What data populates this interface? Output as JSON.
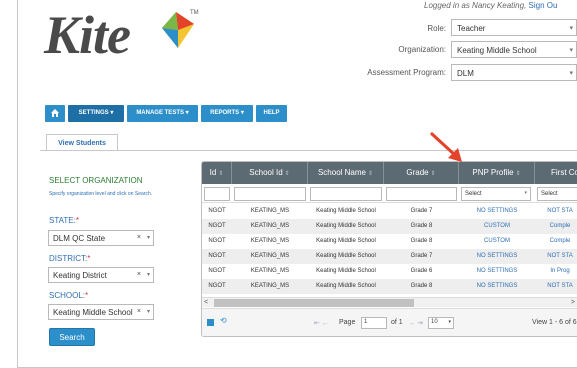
{
  "header": {
    "logo_text": "Kite",
    "logo_tm": "TM",
    "login_text": "Logged in as Nancy Keating,",
    "signout_text": "Sign Ou",
    "role_label": "Role:",
    "role_value": "Teacher",
    "organization_label": "Organization:",
    "organization_value": "Keating Middle School",
    "program_label": "Assessment Program:",
    "program_value": "DLM"
  },
  "nav": {
    "home_icon": "home-icon",
    "items": [
      "SETTINGS ▾",
      "MANAGE TESTS ▾",
      "REPORTS ▾",
      "HELP"
    ]
  },
  "tabs": {
    "view_students": "View Students"
  },
  "left_panel": {
    "title": "SELECT ORGANIZATION",
    "hint": "Specify organization level and click on Search.",
    "state_label": "STATE:",
    "state_value": "DLM QC State",
    "district_label": "DISTRICT:",
    "district_value": "Keating District",
    "school_label": "SCHOOL:",
    "school_value": "Keating Middle School",
    "required_mark": "*",
    "clear_symbol": "×",
    "dropdown_symbol": "▾",
    "search_button": "Search"
  },
  "grid": {
    "columns": [
      "Id",
      "School Id",
      "School Name",
      "Grade",
      "PNP Profile",
      "First Co"
    ],
    "sort_glyph": "⇕",
    "filter_placeholder": "Select",
    "rows": [
      {
        "id": "NGOT",
        "school_id": "KEATING_MS",
        "school_name": "Keating Middle School",
        "grade": "Grade 7",
        "pnp": "NO SETTINGS",
        "first": "NOT STA"
      },
      {
        "id": "NGOT",
        "school_id": "KEATING_MS",
        "school_name": "Keating Middle School",
        "grade": "Grade 8",
        "pnp": "CUSTOM",
        "first": "Comple"
      },
      {
        "id": "NGOT",
        "school_id": "KEATING_MS",
        "school_name": "Keating Middle School",
        "grade": "Grade 8",
        "pnp": "CUSTOM",
        "first": "Comple"
      },
      {
        "id": "NGOT",
        "school_id": "KEATING_MS",
        "school_name": "Keating Middle School",
        "grade": "Grade 7",
        "pnp": "NO SETTINGS",
        "first": "NOT STA"
      },
      {
        "id": "NGOT",
        "school_id": "KEATING_MS",
        "school_name": "Keating Middle School",
        "grade": "Grade 6",
        "pnp": "NO SETTINGS",
        "first": "In Prog"
      },
      {
        "id": "NGOT",
        "school_id": "KEATING_MS",
        "school_name": "Keating Middle School",
        "grade": "Grade 8",
        "pnp": "NO SETTINGS",
        "first": "NOT STA"
      }
    ],
    "pager": {
      "page_label": "Page",
      "page_value": "1",
      "of_label": "of 1",
      "page_size": "10",
      "view_text": "View 1 - 6 of 6",
      "first_prev": "⇤ ←",
      "next_last": "→ ⇥"
    }
  },
  "colors": {
    "accent": "#2d8fc9",
    "grid_header": "#5c6b73",
    "arrow": "#e2432a",
    "link": "#2f6fb3"
  }
}
